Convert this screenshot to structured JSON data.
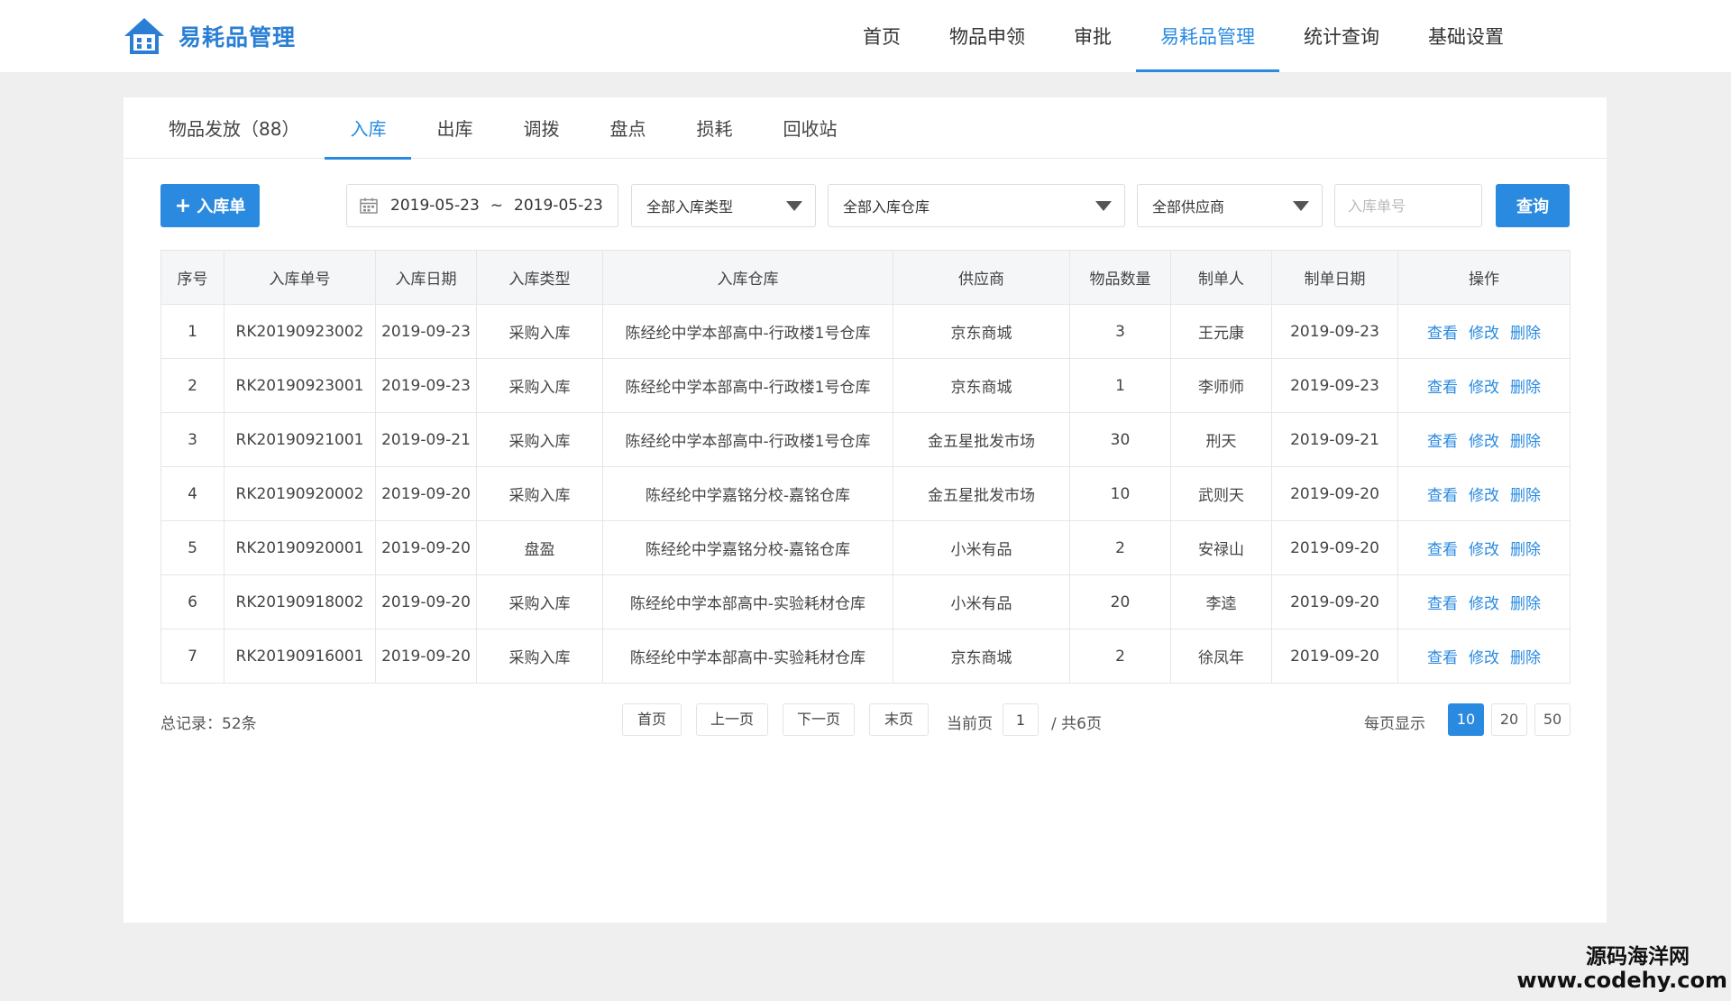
{
  "app": {
    "title": "易耗品管理",
    "brand_color": "#2a8ae0"
  },
  "nav": {
    "items": [
      {
        "label": "首页",
        "active": false
      },
      {
        "label": "物品申领",
        "active": false
      },
      {
        "label": "审批",
        "active": false
      },
      {
        "label": "易耗品管理",
        "active": true
      },
      {
        "label": "统计查询",
        "active": false
      },
      {
        "label": "基础设置",
        "active": false
      }
    ]
  },
  "tabs": [
    {
      "label": "物品发放（88）",
      "active": false
    },
    {
      "label": "入库",
      "active": true
    },
    {
      "label": "出库",
      "active": false
    },
    {
      "label": "调拨",
      "active": false
    },
    {
      "label": "盘点",
      "active": false
    },
    {
      "label": "损耗",
      "active": false
    },
    {
      "label": "回收站",
      "active": false
    }
  ],
  "toolbar": {
    "add_label": "入库单",
    "add_icon": "plus-icon",
    "date_icon": "calendar-icon",
    "date_start": "2019-05-23",
    "date_sep": "~",
    "date_end": "2019-05-23",
    "type_select": "全部入库类型",
    "warehouse_select": "全部入库仓库",
    "supplier_select": "全部供应商",
    "order_no_placeholder": "入库单号",
    "query_label": "查询"
  },
  "table": {
    "columns": [
      "序号",
      "入库单号",
      "入库日期",
      "入库类型",
      "入库仓库",
      "供应商",
      "物品数量",
      "制单人",
      "制单日期",
      "操作"
    ],
    "actions": [
      "查看",
      "修改",
      "删除"
    ],
    "rows": [
      [
        "1",
        "RK20190923002",
        "2019-09-23",
        "采购入库",
        "陈经纶中学本部高中-行政楼1号仓库",
        "京东商城",
        "3",
        "王元康",
        "2019-09-23"
      ],
      [
        "2",
        "RK20190923001",
        "2019-09-23",
        "采购入库",
        "陈经纶中学本部高中-行政楼1号仓库",
        "京东商城",
        "1",
        "李师师",
        "2019-09-23"
      ],
      [
        "3",
        "RK20190921001",
        "2019-09-21",
        "采购入库",
        "陈经纶中学本部高中-行政楼1号仓库",
        "金五星批发市场",
        "30",
        "刑天",
        "2019-09-21"
      ],
      [
        "4",
        "RK20190920002",
        "2019-09-20",
        "采购入库",
        "陈经纶中学嘉铭分校-嘉铭仓库",
        "金五星批发市场",
        "10",
        "武则天",
        "2019-09-20"
      ],
      [
        "5",
        "RK20190920001",
        "2019-09-20",
        "盘盈",
        "陈经纶中学嘉铭分校-嘉铭仓库",
        "小米有品",
        "2",
        "安禄山",
        "2019-09-20"
      ],
      [
        "6",
        "RK20190918002",
        "2019-09-20",
        "采购入库",
        "陈经纶中学本部高中-实验耗材仓库",
        "小米有品",
        "20",
        "李逵",
        "2019-09-20"
      ],
      [
        "7",
        "RK20190916001",
        "2019-09-20",
        "采购入库",
        "陈经纶中学本部高中-实验耗材仓库",
        "京东商城",
        "2",
        "徐凤年",
        "2019-09-20"
      ]
    ]
  },
  "pager": {
    "total": "总记录：52条",
    "first": "首页",
    "prev": "上一页",
    "next": "下一页",
    "last": "末页",
    "current_label": "当前页",
    "current_page": "1",
    "total_pages": "/ 共6页",
    "per_page_label": "每页显示",
    "sizes": [
      "10",
      "20",
      "50"
    ],
    "active_size": "10"
  },
  "watermark": {
    "cn": "源码海洋网",
    "url": "www.codehy.com"
  }
}
